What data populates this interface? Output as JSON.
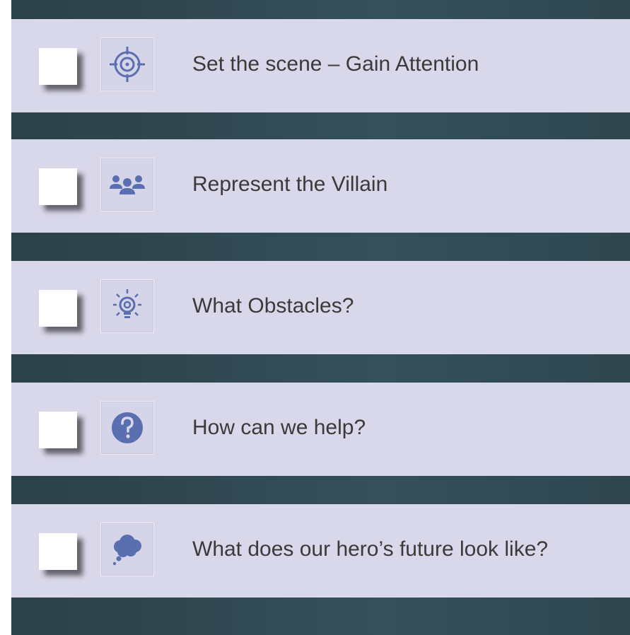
{
  "colors": {
    "background": "#2f464f",
    "row_background": "#d9d8ea",
    "icon_color": "#5a6fb0",
    "text_color": "#3a3a3a"
  },
  "items": [
    {
      "label": "Set the scene – Gain Attention",
      "icon": "target-icon"
    },
    {
      "label": "Represent the Villain",
      "icon": "group-icon"
    },
    {
      "label": "What Obstacles?",
      "icon": "lightbulb-icon"
    },
    {
      "label": "How can we help?",
      "icon": "question-circle-icon"
    },
    {
      "label": "What does our hero’s future look like?",
      "icon": "thought-bubble-icon"
    }
  ]
}
